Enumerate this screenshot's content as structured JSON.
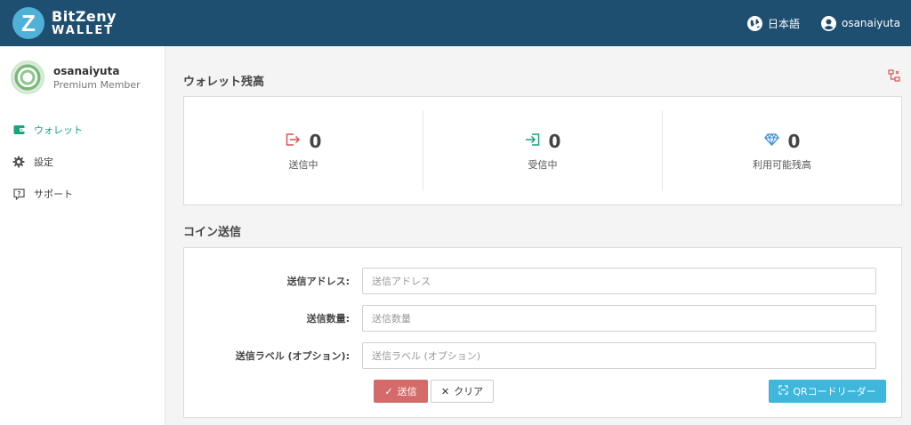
{
  "header": {
    "brand_name": "BitZeny",
    "brand_sub": "WALLET",
    "brand_logo_letter": "Z",
    "language": "日本語",
    "username": "osanaiyuta"
  },
  "sidebar": {
    "profile_name": "osanaiyuta",
    "profile_role": "Premium Member",
    "items": [
      {
        "label": "ウォレット",
        "icon": "wallet-icon",
        "active": true
      },
      {
        "label": "設定",
        "icon": "gear-icon",
        "active": false
      },
      {
        "label": "サポート",
        "icon": "support-icon",
        "active": false
      }
    ]
  },
  "balance": {
    "title": "ウォレット残高",
    "sending": {
      "value": "0",
      "label": "送信中",
      "icon": "sign-out-icon"
    },
    "receiving": {
      "value": "0",
      "label": "受信中",
      "icon": "sign-in-icon"
    },
    "available": {
      "value": "0",
      "label": "利用可能残高",
      "icon": "diamond-icon"
    }
  },
  "send": {
    "title": "コイン送信",
    "address_label": "送信アドレス:",
    "address_placeholder": "送信アドレス",
    "amount_label": "送信数量:",
    "amount_placeholder": "送信数量",
    "memo_label": "送信ラベル (オプション):",
    "memo_placeholder": "送信ラベル (オプション)",
    "send_button": "送信",
    "clear_button": "クリア",
    "qr_button": "QRコードリーダー"
  },
  "colors": {
    "header_bg": "#1e4e70",
    "accent_green": "#1aa37f",
    "send_red": "#d46a6a",
    "qr_blue": "#3fb6dc",
    "diamond_blue": "#3a8fd6"
  }
}
